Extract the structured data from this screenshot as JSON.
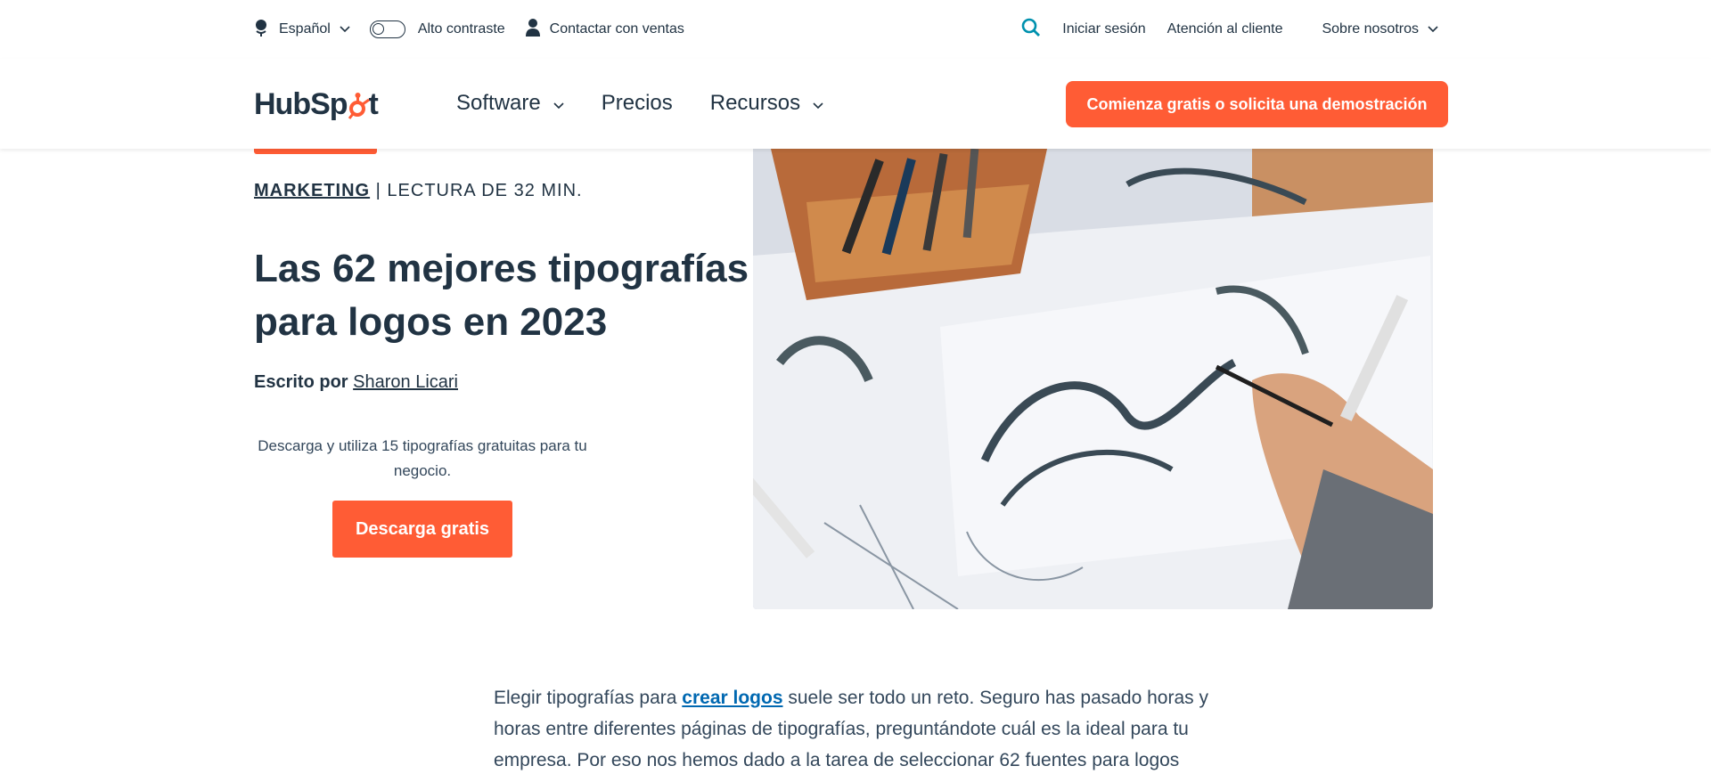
{
  "utility_bar": {
    "language": "Español",
    "contrast": "Alto contraste",
    "sales": "Contactar con ventas",
    "login": "Iniciar sesión",
    "support": "Atención al cliente",
    "about": "Sobre nosotros"
  },
  "nav": {
    "logo_left": "HubSp",
    "logo_right": "t",
    "items": [
      {
        "label": "Software"
      },
      {
        "label": "Precios"
      },
      {
        "label": "Recursos"
      }
    ],
    "cta": "Comienza gratis o solicita una demostración"
  },
  "article": {
    "category": "MARKETING",
    "reading_time": "| LECTURA DE 32 MIN.",
    "title": "Las 62 mejores tipografías para logos en 2023",
    "author_label": "Escrito por",
    "author_name": "Sharon Licari",
    "offer_text": "Descarga y utiliza 15 tipografías gratuitas para tu negocio.",
    "offer_cta": "Descarga gratis",
    "intro_before_link": "Elegir tipografías para ",
    "intro_link": "crear logos",
    "intro_after_link": " suele ser todo un reto. Seguro has pasado horas y horas entre diferentes páginas de tipografías, preguntándote cuál es la ideal para tu empresa. Por eso nos hemos dado a la tarea de seleccionar 62 fuentes para logos"
  },
  "colors": {
    "brand_orange": "#ff5c35",
    "text_dark": "#213343",
    "link_blue": "#0068b1"
  }
}
